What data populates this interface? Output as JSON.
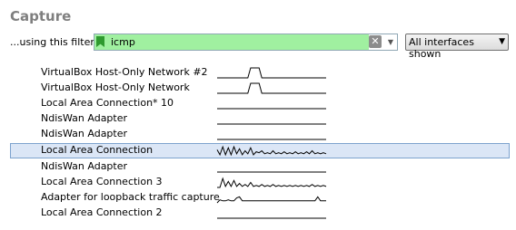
{
  "capture": {
    "title": "Capture",
    "filter_label": "...using this filter:",
    "filter_value": "icmp",
    "interfaces_dropdown": "All interfaces shown",
    "interfaces": [
      {
        "name": "VirtualBox Host-Only Network #2",
        "selected": false,
        "sparkline": [
          0,
          0,
          0,
          0,
          0,
          0,
          0,
          0,
          0,
          0,
          0,
          0,
          1,
          1,
          1,
          1,
          0,
          0,
          0,
          0,
          0,
          0,
          0,
          0,
          0,
          0,
          0,
          0,
          0,
          0,
          0,
          0,
          0,
          0,
          0,
          0,
          0,
          0,
          0,
          0
        ]
      },
      {
        "name": "VirtualBox Host-Only Network",
        "selected": false,
        "sparkline": [
          0,
          0,
          0,
          0,
          0,
          0,
          0,
          0,
          0,
          0,
          0,
          0,
          1,
          1,
          1,
          1,
          0,
          0,
          0,
          0,
          0,
          0,
          0,
          0,
          0,
          0,
          0,
          0,
          0,
          0,
          0,
          0,
          0,
          0,
          0,
          0,
          0,
          0,
          0,
          0
        ]
      },
      {
        "name": "Local Area Connection* 10",
        "selected": false,
        "sparkline": [
          0,
          0,
          0,
          0,
          0,
          0,
          0,
          0,
          0,
          0,
          0,
          0,
          0,
          0,
          0,
          0,
          0,
          0,
          0,
          0,
          0,
          0,
          0,
          0,
          0,
          0,
          0,
          0,
          0,
          0,
          0,
          0,
          0,
          0,
          0,
          0,
          0,
          0,
          0,
          0
        ]
      },
      {
        "name": "NdisWan Adapter",
        "selected": false,
        "sparkline": [
          0,
          0,
          0,
          0,
          0,
          0,
          0,
          0,
          0,
          0,
          0,
          0,
          0,
          0,
          0,
          0,
          0,
          0,
          0,
          0,
          0,
          0,
          0,
          0,
          0,
          0,
          0,
          0,
          0,
          0,
          0,
          0,
          0,
          0,
          0,
          0,
          0,
          0,
          0,
          0
        ]
      },
      {
        "name": "NdisWan Adapter",
        "selected": false,
        "sparkline": [
          0,
          0,
          0,
          0,
          0,
          0,
          0,
          0,
          0,
          0,
          0,
          0,
          0,
          0,
          0,
          0,
          0,
          0,
          0,
          0,
          0,
          0,
          0,
          0,
          0,
          0,
          0,
          0,
          0,
          0,
          0,
          0,
          0,
          0,
          0,
          0,
          0,
          0,
          0,
          0
        ]
      },
      {
        "name": "Local Area Connection",
        "selected": true,
        "sparkline": [
          0.6,
          0.1,
          0.9,
          0.1,
          0.8,
          0.1,
          0.9,
          0.2,
          0.7,
          0.1,
          0.5,
          0.2,
          0.8,
          0.1,
          0.4,
          0.3,
          0.5,
          0.2,
          0.3,
          0.2,
          0.5,
          0.2,
          0.3,
          0.2,
          0.4,
          0.2,
          0.3,
          0.2,
          0.4,
          0.2,
          0.3,
          0.2,
          0.4,
          0.2,
          0.5,
          0.2,
          0.3,
          0.2,
          0.3,
          0.2
        ]
      },
      {
        "name": "NdisWan Adapter",
        "selected": false,
        "sparkline": [
          0,
          0,
          0,
          0,
          0,
          0,
          0,
          0,
          0,
          0,
          0,
          0,
          0,
          0,
          0,
          0,
          0,
          0,
          0,
          0,
          0,
          0,
          0,
          0,
          0,
          0,
          0,
          0,
          0,
          0,
          0,
          0,
          0,
          0,
          0,
          0,
          0,
          0,
          0,
          0
        ]
      },
      {
        "name": "Local Area Connection 3",
        "selected": false,
        "sparkline": [
          0,
          0,
          0.9,
          0.1,
          0.6,
          0.1,
          0.7,
          0.1,
          0.4,
          0.1,
          0.3,
          0.1,
          0.5,
          0.1,
          0.2,
          0.1,
          0.3,
          0.1,
          0.2,
          0.1,
          0.3,
          0.1,
          0.2,
          0.1,
          0.2,
          0.1,
          0.2,
          0.1,
          0.2,
          0.1,
          0.2,
          0.1,
          0.2,
          0.1,
          0.3,
          0.1,
          0.2,
          0.1,
          0.2,
          0.1
        ]
      },
      {
        "name": "Adapter for loopback traffic capture",
        "selected": false,
        "sparkline": [
          0,
          0.3,
          0.2,
          0.2,
          0.3,
          0.2,
          0.2,
          0.5,
          0.6,
          0.2,
          0.2,
          0.2,
          0.2,
          0.2,
          0.2,
          0.2,
          0.2,
          0.2,
          0.2,
          0.2,
          0.2,
          0.2,
          0.2,
          0.2,
          0.2,
          0.2,
          0.2,
          0.2,
          0.2,
          0.2,
          0.2,
          0.2,
          0.2,
          0.2,
          0.2,
          0.2,
          0.6,
          0.2,
          0.2,
          0.2
        ]
      },
      {
        "name": "Local Area Connection 2",
        "selected": false,
        "sparkline": [
          0,
          0,
          0,
          0,
          0,
          0,
          0,
          0,
          0,
          0,
          0,
          0,
          0,
          0,
          0,
          0,
          0,
          0,
          0,
          0,
          0,
          0,
          0,
          0,
          0,
          0,
          0,
          0,
          0,
          0,
          0,
          0,
          0,
          0,
          0,
          0,
          0,
          0,
          0,
          0
        ]
      }
    ]
  }
}
